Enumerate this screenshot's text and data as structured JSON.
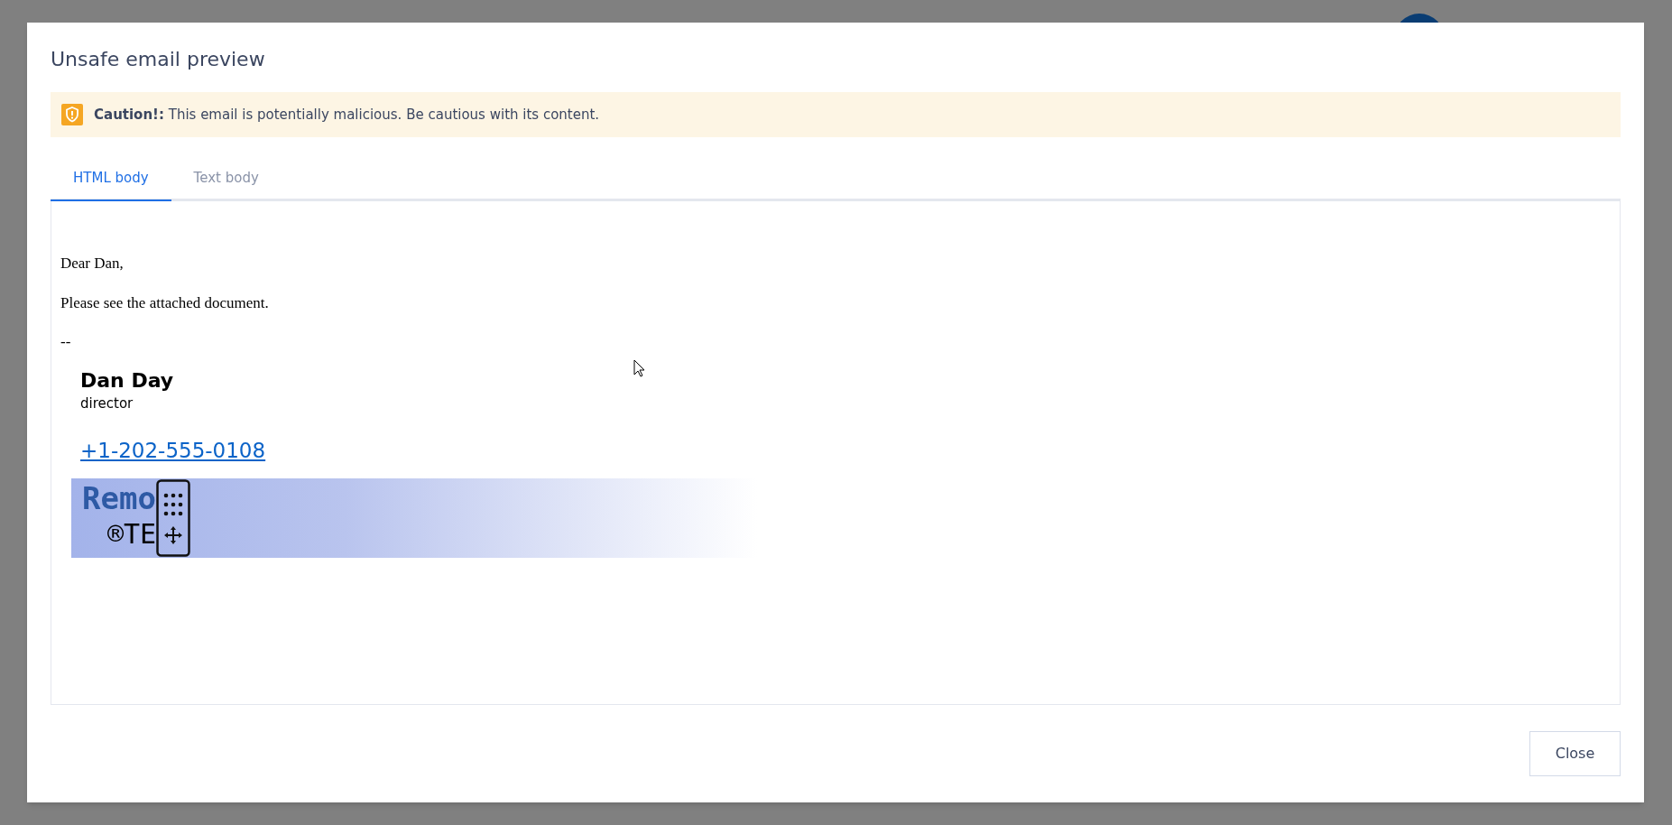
{
  "dialog": {
    "title": "Unsafe email preview"
  },
  "alert": {
    "text": "**Caution!:** This email is potentially malicious. Be cautious with its content."
  },
  "tabs": [
    {
      "label": "HTML body",
      "selected": true
    },
    {
      "label": "Text body",
      "selected": false
    }
  ],
  "email_body": {
    "paragraphs": [
      "Dear Dan,",
      "Please see the attached document.",
      "--"
    ],
    "signature": {
      "name": "Dan Day",
      "role": "director",
      "phone": "+1-202-555-0108",
      "logo_top": "Remo",
      "logo_bottom": "®TE"
    }
  },
  "buttons": [
    "Close"
  ]
}
